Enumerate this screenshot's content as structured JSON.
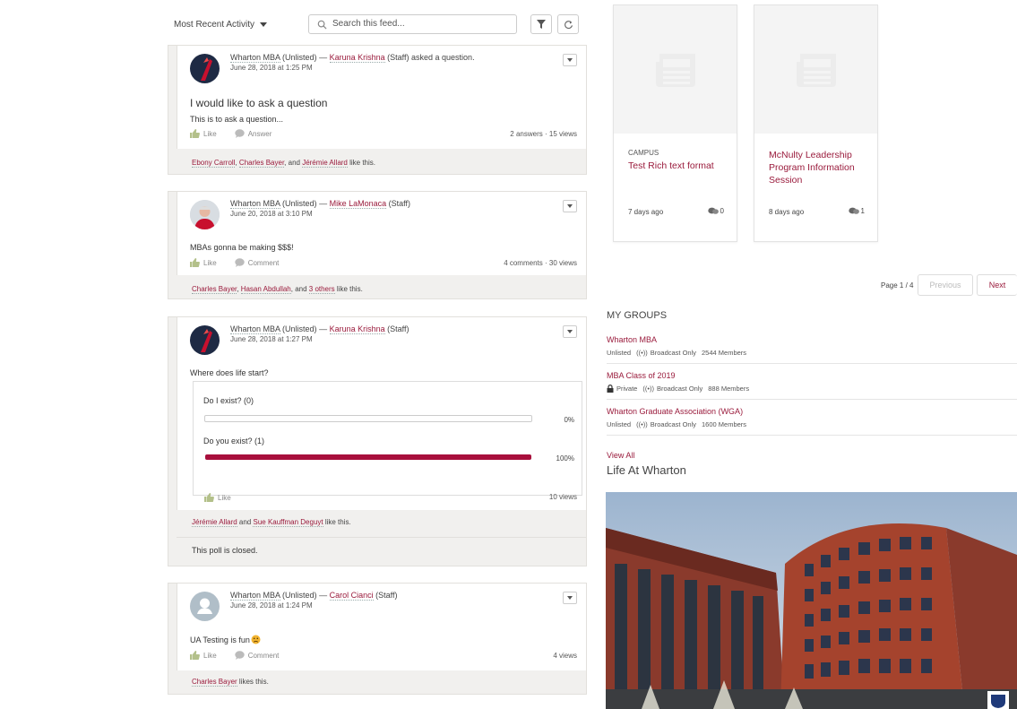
{
  "toolbar": {
    "sort_label": "Most Recent Activity",
    "search_placeholder": "Search this feed..."
  },
  "posts": [
    {
      "group": "Wharton MBA",
      "visibility": "(Unlisted)",
      "dash": "—",
      "author": "Karuna Krishna",
      "author_role": "(Staff)",
      "action": "asked a question.",
      "date": "June 28, 2018 at 1:25 PM",
      "title": "I would like to ask a question",
      "body": "This is to ask a question...",
      "like_label": "Like",
      "second_action": "Answer",
      "stats": "2 answers · 15 views",
      "likes": {
        "names": [
          "Ebony Carroll",
          "Charles Bayer"
        ],
        "sep": ", ",
        "and": ", and ",
        "last": "Jérémie Allard",
        "suffix": " like this."
      }
    },
    {
      "group": "Wharton MBA",
      "visibility": "(Unlisted)",
      "dash": "—",
      "author": "Mike LaMonaca",
      "author_role": "(Staff)",
      "date": "June 20, 2018 at 3:10 PM",
      "body": "MBAs gonna be making $$$!",
      "like_label": "Like",
      "second_action": "Comment",
      "stats": "4 comments · 30 views",
      "likes": {
        "a": "Charles Bayer",
        "b": "Hasan Abdullah",
        "and": ", and ",
        "c": "3 others",
        "sep": ", ",
        "suffix": " like this."
      }
    },
    {
      "group": "Wharton MBA",
      "visibility": "(Unlisted)",
      "dash": "—",
      "author": "Karuna Krishna",
      "author_role": "(Staff)",
      "date": "June 28, 2018 at 1:27 PM",
      "body": "Where does life start?",
      "poll": [
        {
          "label": "Do I exist? (0)",
          "pct_text": "0%",
          "pct": 0
        },
        {
          "label": "Do you exist? (1)",
          "pct_text": "100%",
          "pct": 100
        }
      ],
      "like_label": "Like",
      "stats": "10 views",
      "likes": {
        "a": "Jérémie Allard",
        "and": " and ",
        "b": "Sue Kauffman Deguyt",
        "suffix": " like this."
      },
      "closed": "This poll is closed."
    },
    {
      "group": "Wharton MBA",
      "visibility": "(Unlisted)",
      "dash": "—",
      "author": "Carol Cianci",
      "author_role": "(Staff)",
      "date": "June 28, 2018 at 1:24 PM",
      "body": "UA Testing is fun",
      "like_label": "Like",
      "second_action": "Comment",
      "stats": "4 views",
      "likes": {
        "a": "Charles Bayer",
        "suffix": " likes this."
      }
    }
  ],
  "tiles": [
    {
      "category": "CAMPUS",
      "title": "Test Rich text format",
      "ago": "7 days ago",
      "count": "0"
    },
    {
      "category": "",
      "title": "McNulty Leadership Program Information Session",
      "ago": "8 days ago",
      "count": "1"
    }
  ],
  "pagination": {
    "label": "Page 1 / 4",
    "previous": "Previous",
    "next": "Next"
  },
  "groups": {
    "heading": "MY GROUPS",
    "items": [
      {
        "name": "Wharton MBA",
        "privacy": "Unlisted",
        "broadcast": "Broadcast Only",
        "members": "2544 Members"
      },
      {
        "name": "MBA Class of 2019",
        "privacy": "Private",
        "broadcast": "Broadcast Only",
        "members": "888 Members"
      },
      {
        "name": "Wharton Graduate Association (WGA)",
        "privacy": "Unlisted",
        "broadcast": "Broadcast Only",
        "members": "1600 Members"
      }
    ],
    "view_all": "View All"
  },
  "life": {
    "heading": "Life At Wharton"
  },
  "colors": {
    "accent": "#9a1b3c",
    "poll_bar": "#a80f3c",
    "card_bg": "#f1f0ee"
  }
}
